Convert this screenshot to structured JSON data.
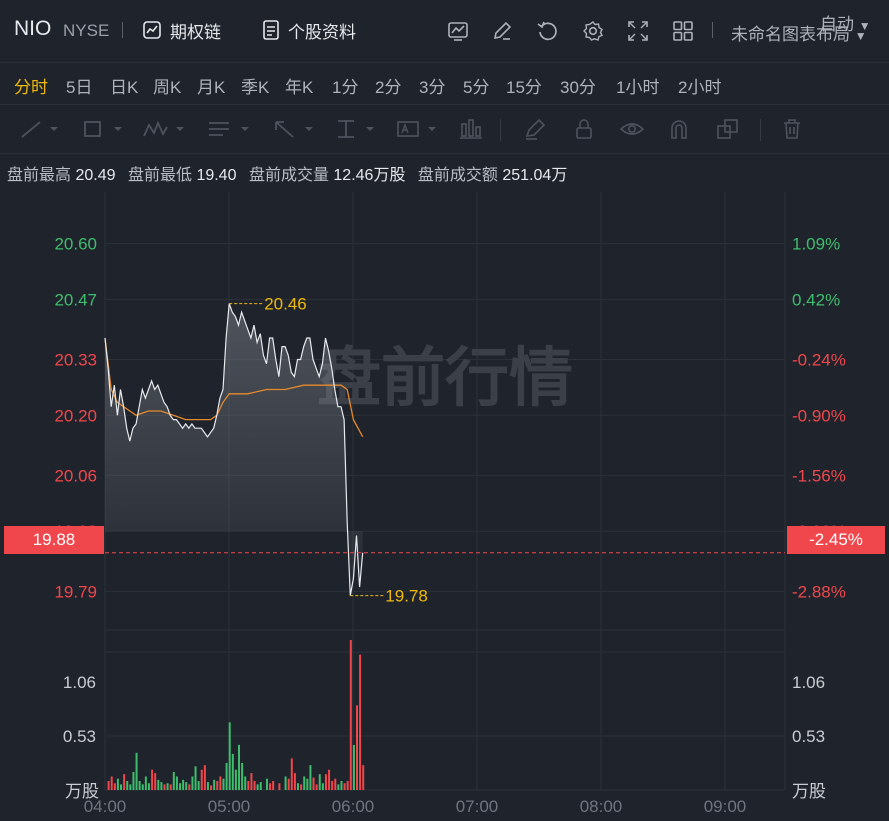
{
  "header": {
    "symbol": "NIO",
    "exchange": "NYSE",
    "options_chain_label": "期权链",
    "stock_profile_label": "个股资料",
    "layout_name": "未命名图表布局"
  },
  "periods": [
    "分时",
    "5日",
    "日K",
    "周K",
    "月K",
    "季K",
    "年K",
    "1分",
    "2分",
    "3分",
    "5分",
    "15分",
    "30分",
    "1小时",
    "2小时"
  ],
  "active_period": "分时",
  "auto_label": "自动",
  "premarket": {
    "high_label": "盘前最高",
    "high": "20.49",
    "low_label": "盘前最低",
    "low": "19.40",
    "volume_label": "盘前成交量",
    "volume": "12.46万股",
    "amount_label": "盘前成交额",
    "amount": "251.04万"
  },
  "watermark": "盘前行情",
  "colors": {
    "up": "#3ebd6e",
    "down": "#f0474c",
    "accent": "#f0b90b",
    "price_line": "#e8eaee",
    "avg_line": "#e58a2b"
  },
  "chart_data": {
    "type": "line",
    "x_ticks": [
      "04:00",
      "05:00",
      "06:00",
      "07:00",
      "08:00",
      "09:00"
    ],
    "price_ticks": [
      "20.60",
      "20.47",
      "20.33",
      "20.20",
      "20.06",
      "19.93",
      "19.79"
    ],
    "pct_ticks": [
      "1.09%",
      "0.42%",
      "-0.24%",
      "-0.90%",
      "-1.56%",
      "-2.22%",
      "-2.88%"
    ],
    "price_range": [
      19.7,
      20.72
    ],
    "current_price": "19.88",
    "current_pct": "-2.45%",
    "high_marker": "20.46",
    "low_marker": "19.78",
    "volume_ticks": [
      "1.06",
      "0.53"
    ],
    "volume_unit": "万股",
    "volume_max": 1.33,
    "price_series": [
      [
        0,
        20.38
      ],
      [
        1,
        20.31
      ],
      [
        2,
        20.22
      ],
      [
        3,
        20.27
      ],
      [
        4,
        20.2
      ],
      [
        5,
        20.26
      ],
      [
        6,
        20.22
      ],
      [
        7,
        20.17
      ],
      [
        8,
        20.14
      ],
      [
        9,
        20.17
      ],
      [
        10,
        20.18
      ],
      [
        11,
        20.22
      ],
      [
        12,
        20.26
      ],
      [
        13,
        20.24
      ],
      [
        14,
        20.26
      ],
      [
        15,
        20.28
      ],
      [
        16,
        20.26
      ],
      [
        17,
        20.27
      ],
      [
        18,
        20.25
      ],
      [
        19,
        20.23
      ],
      [
        20,
        20.22
      ],
      [
        21,
        20.2
      ],
      [
        22,
        20.19
      ],
      [
        23,
        20.19
      ],
      [
        24,
        20.18
      ],
      [
        25,
        20.17
      ],
      [
        26,
        20.18
      ],
      [
        27,
        20.17
      ],
      [
        28,
        20.18
      ],
      [
        29,
        20.17
      ],
      [
        30,
        20.17
      ],
      [
        31,
        20.17
      ],
      [
        32,
        20.16
      ],
      [
        33,
        20.15
      ],
      [
        34,
        20.16
      ],
      [
        35,
        20.17
      ],
      [
        36,
        20.2
      ],
      [
        37,
        20.24
      ],
      [
        38,
        20.26
      ],
      [
        39,
        20.38
      ],
      [
        40,
        20.46
      ],
      [
        41,
        20.44
      ],
      [
        42,
        20.43
      ],
      [
        43,
        20.41
      ],
      [
        44,
        20.44
      ],
      [
        45,
        20.42
      ],
      [
        46,
        20.4
      ],
      [
        47,
        20.38
      ],
      [
        48,
        20.41
      ],
      [
        49,
        20.37
      ],
      [
        50,
        20.39
      ],
      [
        51,
        20.34
      ],
      [
        52,
        20.32
      ],
      [
        53,
        20.38
      ],
      [
        54,
        20.38
      ],
      [
        55,
        20.33
      ],
      [
        56,
        20.29
      ],
      [
        57,
        20.36
      ],
      [
        58,
        20.36
      ],
      [
        59,
        20.34
      ],
      [
        60,
        20.3
      ],
      [
        61,
        20.29
      ],
      [
        62,
        20.33
      ],
      [
        63,
        20.33
      ],
      [
        64,
        20.36
      ],
      [
        65,
        20.38
      ],
      [
        66,
        20.38
      ],
      [
        67,
        20.33
      ],
      [
        68,
        20.31
      ],
      [
        69,
        20.29
      ],
      [
        70,
        20.32
      ],
      [
        71,
        20.38
      ],
      [
        72,
        20.35
      ],
      [
        73,
        20.31
      ],
      [
        74,
        20.26
      ],
      [
        75,
        20.22
      ],
      [
        76,
        20.22
      ],
      [
        77,
        20.19
      ],
      [
        78,
        19.95
      ],
      [
        79,
        19.78
      ],
      [
        80,
        19.82
      ],
      [
        81,
        19.92
      ],
      [
        82,
        19.8
      ],
      [
        83,
        19.88
      ]
    ],
    "avg_series": [
      [
        0,
        20.38
      ],
      [
        2,
        20.26
      ],
      [
        4,
        20.23
      ],
      [
        6,
        20.22
      ],
      [
        8,
        20.21
      ],
      [
        10,
        20.2
      ],
      [
        14,
        20.21
      ],
      [
        18,
        20.21
      ],
      [
        22,
        20.2
      ],
      [
        26,
        20.19
      ],
      [
        30,
        20.19
      ],
      [
        34,
        20.19
      ],
      [
        36,
        20.2
      ],
      [
        38,
        20.23
      ],
      [
        40,
        20.25
      ],
      [
        46,
        20.25
      ],
      [
        52,
        20.26
      ],
      [
        58,
        20.26
      ],
      [
        64,
        20.27
      ],
      [
        70,
        20.27
      ],
      [
        76,
        20.27
      ],
      [
        78,
        20.26
      ],
      [
        80,
        20.19
      ],
      [
        83,
        20.15
      ]
    ],
    "volume_series": [
      [
        1,
        0.08,
        "down"
      ],
      [
        2,
        0.12,
        "down"
      ],
      [
        3,
        0.06,
        "down"
      ],
      [
        4,
        0.1,
        "up"
      ],
      [
        5,
        0.05,
        "up"
      ],
      [
        6,
        0.14,
        "down"
      ],
      [
        7,
        0.08,
        "up"
      ],
      [
        8,
        0.05,
        "up"
      ],
      [
        9,
        0.16,
        "up"
      ],
      [
        10,
        0.33,
        "up"
      ],
      [
        11,
        0.08,
        "up"
      ],
      [
        12,
        0.05,
        "up"
      ],
      [
        13,
        0.12,
        "up"
      ],
      [
        14,
        0.06,
        "up"
      ],
      [
        15,
        0.18,
        "down"
      ],
      [
        16,
        0.15,
        "down"
      ],
      [
        17,
        0.09,
        "up"
      ],
      [
        18,
        0.07,
        "up"
      ],
      [
        19,
        0.05,
        "down"
      ],
      [
        20,
        0.06,
        "up"
      ],
      [
        21,
        0.05,
        "down"
      ],
      [
        22,
        0.16,
        "up"
      ],
      [
        23,
        0.12,
        "up"
      ],
      [
        24,
        0.06,
        "up"
      ],
      [
        25,
        0.09,
        "up"
      ],
      [
        26,
        0.07,
        "up"
      ],
      [
        27,
        0.05,
        "down"
      ],
      [
        28,
        0.12,
        "up"
      ],
      [
        29,
        0.21,
        "up"
      ],
      [
        30,
        0.08,
        "up"
      ],
      [
        31,
        0.18,
        "down"
      ],
      [
        32,
        0.22,
        "down"
      ],
      [
        33,
        0.07,
        "up"
      ],
      [
        34,
        0.04,
        "down"
      ],
      [
        35,
        0.09,
        "up"
      ],
      [
        36,
        0.08,
        "down"
      ],
      [
        37,
        0.12,
        "down"
      ],
      [
        38,
        0.1,
        "up"
      ],
      [
        39,
        0.24,
        "up"
      ],
      [
        40,
        0.6,
        "up"
      ],
      [
        41,
        0.32,
        "up"
      ],
      [
        42,
        0.18,
        "up"
      ],
      [
        43,
        0.4,
        "up"
      ],
      [
        44,
        0.24,
        "up"
      ],
      [
        45,
        0.12,
        "up"
      ],
      [
        46,
        0.08,
        "down"
      ],
      [
        47,
        0.15,
        "down"
      ],
      [
        48,
        0.08,
        "down"
      ],
      [
        49,
        0.05,
        "up"
      ],
      [
        50,
        0.07,
        "up"
      ],
      [
        52,
        0.1,
        "up"
      ],
      [
        53,
        0.06,
        "down"
      ],
      [
        54,
        0.08,
        "down"
      ],
      [
        56,
        0.06,
        "down"
      ],
      [
        58,
        0.12,
        "up"
      ],
      [
        59,
        0.1,
        "down"
      ],
      [
        60,
        0.28,
        "down"
      ],
      [
        61,
        0.15,
        "down"
      ],
      [
        62,
        0.06,
        "up"
      ],
      [
        63,
        0.05,
        "down"
      ],
      [
        64,
        0.12,
        "up"
      ],
      [
        65,
        0.1,
        "up"
      ],
      [
        66,
        0.22,
        "up"
      ],
      [
        67,
        0.11,
        "down"
      ],
      [
        68,
        0.05,
        "down"
      ],
      [
        69,
        0.14,
        "up"
      ],
      [
        70,
        0.06,
        "up"
      ],
      [
        71,
        0.14,
        "down"
      ],
      [
        72,
        0.18,
        "down"
      ],
      [
        73,
        0.08,
        "down"
      ],
      [
        74,
        0.1,
        "down"
      ],
      [
        75,
        0.05,
        "up"
      ],
      [
        76,
        0.08,
        "up"
      ],
      [
        77,
        0.06,
        "down"
      ],
      [
        78,
        0.08,
        "down"
      ],
      [
        79,
        1.33,
        "down"
      ],
      [
        80,
        0.4,
        "up"
      ],
      [
        81,
        0.75,
        "down"
      ],
      [
        82,
        1.2,
        "down"
      ],
      [
        83,
        0.22,
        "down"
      ]
    ]
  }
}
